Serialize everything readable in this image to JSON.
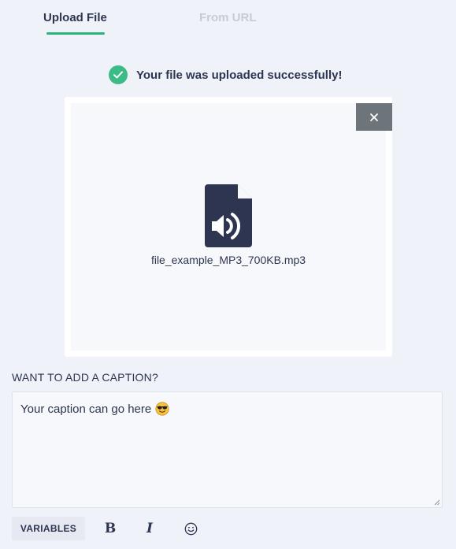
{
  "tabs": [
    {
      "label": "Upload File",
      "active": true
    },
    {
      "label": "From URL",
      "active": false
    }
  ],
  "upload": {
    "success_message": "Your file was uploaded successfully!",
    "file_name": "file_example_MP3_700KB.mp3",
    "file_icon": "audio-file-icon",
    "remove_icon": "close-icon"
  },
  "caption": {
    "label": "WANT TO ADD A CAPTION?",
    "value": "Your caption can go here",
    "emoji": "sunglasses-face-emoji"
  },
  "toolbar": {
    "variables_label": "VARIABLES",
    "bold_label": "B",
    "italic_label": "I",
    "emoji_icon": "smiley-icon"
  },
  "colors": {
    "accent": "#2bb37f",
    "success": "#3dbb87",
    "text": "#2d3551",
    "inactive_tab": "#c7cbd6",
    "background": "#eff2f8",
    "remove_button": "#6d747a"
  }
}
